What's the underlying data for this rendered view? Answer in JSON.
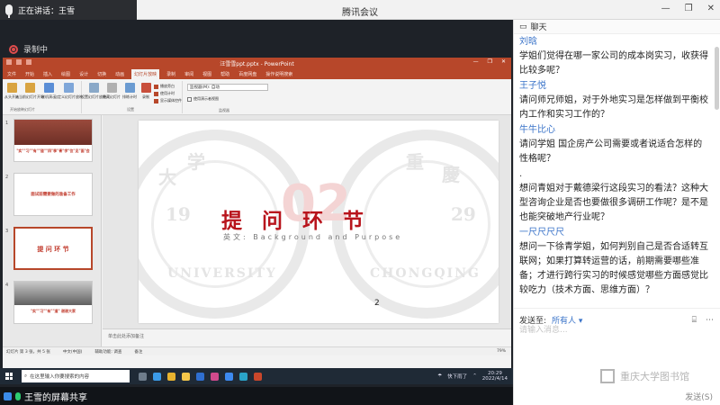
{
  "meeting": {
    "speaker_label": "正在讲话：王雪",
    "title": "腾讯会议",
    "recording_label": "录制中",
    "sharing_label": "王雪的屏幕共享",
    "window_buttons": [
      "—",
      "❐",
      "✕"
    ]
  },
  "powerpoint": {
    "window_title": "汪雪雪ppt.pptx - PowerPoint",
    "tabs": [
      "文件",
      "开始",
      "插入",
      "绘图",
      "设计",
      "切换",
      "动画",
      "幻灯片放映",
      "录制",
      "审阅",
      "视图",
      "帮助",
      "百度网盘",
      "操作说明搜索"
    ],
    "active_tab": "幻灯片放映",
    "ribbon": {
      "buttons": [
        "从头开始",
        "从当前幻灯片开始",
        "联机演示",
        "自定义幻灯片放映",
        "设置幻灯片放映",
        "隐藏幻灯片",
        "排练计时",
        "录制"
      ],
      "checkboxes": [
        {
          "label": "播放旁白",
          "checked": true
        },
        {
          "label": "使用计时",
          "checked": true
        },
        {
          "label": "显示媒体控件",
          "checked": true
        },
        {
          "label": "使用演示者视图",
          "checked": false
        }
      ],
      "monitor_label": "监视器(M): 自动",
      "group_labels": [
        "开始放映幻灯片",
        "设置",
        "监视器"
      ]
    },
    "thumbnails": [
      {
        "num": "1",
        "text": "\"实\"\"习\"\"有\"\"道\"\"四\"季\"青\"学\"位\"见\"面\"会"
      },
      {
        "num": "2",
        "text": "面试前需要做的准备工作"
      },
      {
        "num": "3",
        "text": "提 问 环 节"
      },
      {
        "num": "4",
        "text": "\"实\"\"习\"\"有\"\"道\" 谢谢大家"
      }
    ],
    "slide": {
      "big_number": "02",
      "title": "提问环节",
      "subtitle": "英文: Background and Purpose",
      "page_number": "2",
      "seal_left_words": [
        "大",
        "学",
        "19",
        "UNIVERSITY"
      ],
      "seal_right_words": [
        "重",
        "慶",
        "29",
        "CHONGQING"
      ]
    },
    "notes_placeholder": "单击此处添加备注",
    "status": {
      "slide_info": "幻灯片 第 3 张，共 5 张",
      "language": "中文(中国)",
      "accessibility": "辅助功能: 调查",
      "notes": "备注",
      "zoom": "79%"
    }
  },
  "taskbar": {
    "search_placeholder": "在这里输入你要搜索的内容",
    "tray_text": "快下雨了",
    "time": "20:29",
    "date": "2022/4/14"
  },
  "chat": {
    "title": "聊天",
    "messages": [
      {
        "name": "刘晗",
        "text": "学姐们觉得在哪一家公司的成本岗实习，收获得比较多呢？"
      },
      {
        "name": "王子悦",
        "text": "请问师兄师姐，对于外地实习是怎样做到平衡校内工作和实习工作的？"
      },
      {
        "name": "牛牛比心",
        "text": "请问学姐 国企房产公司需要或者说适合怎样的性格呢？"
      },
      {
        "name": ".",
        "text": "想问青姐对于戴德梁行这段实习的看法？这种大型咨询企业是否也要做很多调研工作呢？是不是也能突破地产行业呢？"
      },
      {
        "name": "一尺尺尺尺",
        "text": "想问一下徐青学姐，如何判别自己是否合适转互联网；如果打算转运营的话，前期需要哪些准备；才进行跨行实习的时候感觉哪些方面感觉比较吃力（技术方面、思维方面）？"
      }
    ],
    "send_to_label": "发送至:",
    "send_to_value": "所有人",
    "input_placeholder": "请输入消息...",
    "send_button": "发送(S)",
    "watermark": "重庆大学图书馆"
  }
}
